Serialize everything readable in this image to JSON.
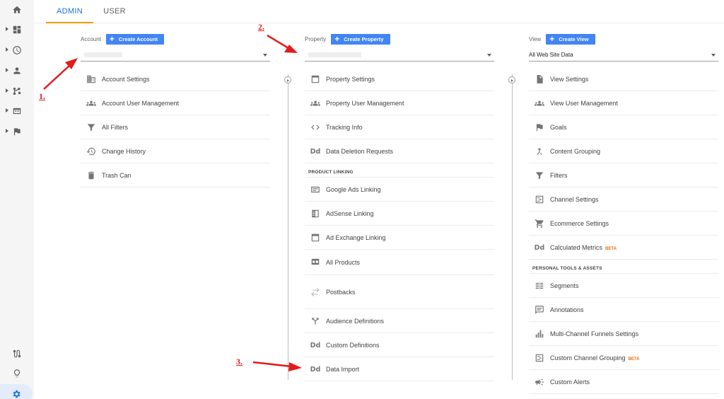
{
  "tabs": {
    "admin": "ADMIN",
    "user": "USER"
  },
  "account": {
    "label": "Account",
    "create": "Create Account",
    "items": [
      "Account Settings",
      "Account User Management",
      "All Filters",
      "Change History",
      "Trash Can"
    ]
  },
  "property": {
    "label": "Property",
    "create": "Create Property",
    "items": [
      "Property Settings",
      "Property User Management",
      "Tracking Info",
      "Data Deletion Requests"
    ],
    "section": "PRODUCT LINKING",
    "linking": [
      "Google Ads Linking",
      "AdSense Linking",
      "Ad Exchange Linking",
      "All Products",
      "Postbacks",
      "Audience Definitions",
      "Custom Definitions",
      "Data Import"
    ]
  },
  "view": {
    "label": "View",
    "create": "Create View",
    "selected": "All Web Site Data",
    "items": [
      "View Settings",
      "View User Management",
      "Goals",
      "Content Grouping",
      "Filters",
      "Channel Settings",
      "Ecommerce Settings",
      "Calculated Metrics"
    ],
    "section": "PERSONAL TOOLS & ASSETS",
    "tools": [
      "Segments",
      "Annotations",
      "Multi-Channel Funnels Settings",
      "Custom Channel Grouping",
      "Custom Alerts"
    ],
    "beta": "BETA"
  },
  "annotations": {
    "a1": "1.",
    "a2": "2.",
    "a3": "3."
  },
  "colors": {
    "accent": "#1a73e8",
    "button": "#4285f4",
    "tab_indicator": "#f29900",
    "annotation": "#e31b1b",
    "beta": "#e8710a"
  },
  "icons": {
    "rail": [
      "home-icon",
      "dashboard-icon",
      "clock-icon",
      "person-icon",
      "acquisition-icon",
      "behavior-icon",
      "flag-icon",
      "route-icon",
      "lightbulb-icon",
      "gear-icon"
    ]
  }
}
